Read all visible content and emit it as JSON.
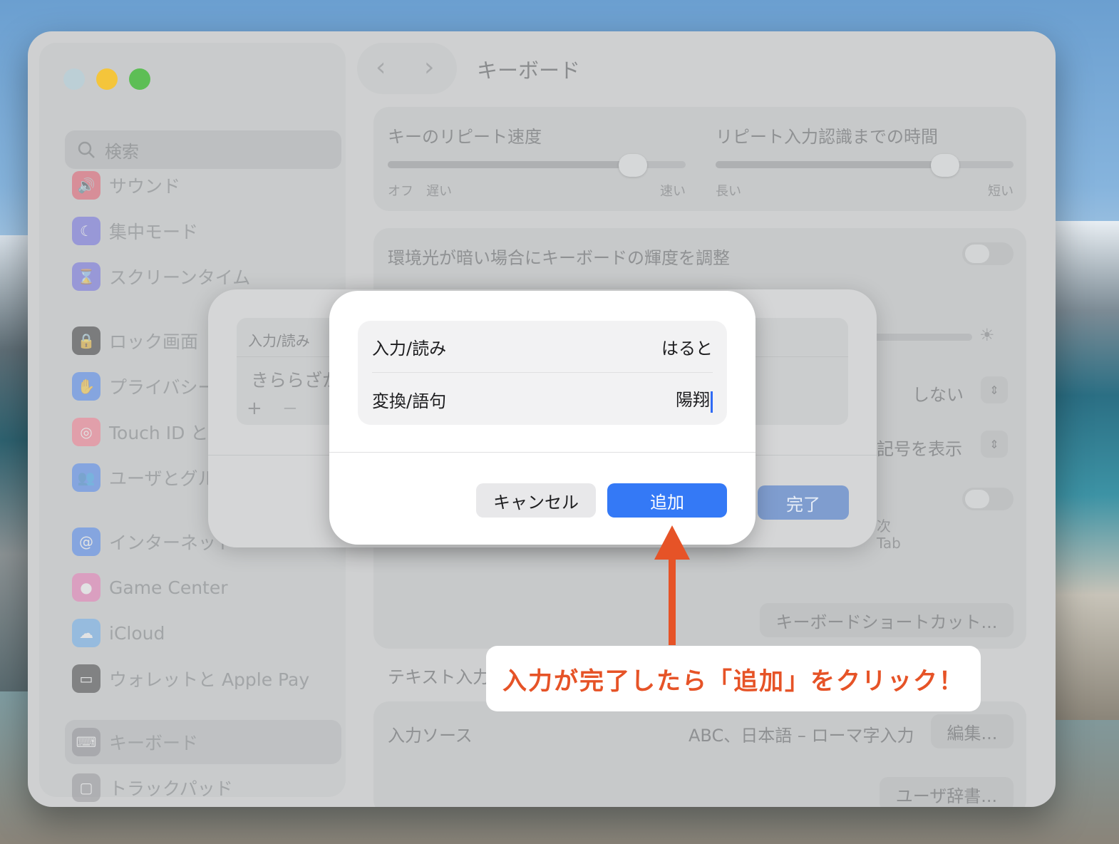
{
  "window": {
    "title": "キーボード",
    "nav_back": "‹",
    "nav_forward": "›"
  },
  "sidebar": {
    "search_placeholder": "検索",
    "items": [
      {
        "label": "サウンド",
        "icon": "speaker-icon",
        "color": "#e8455a"
      },
      {
        "label": "集中モード",
        "icon": "moon-icon",
        "color": "#5e5ce6"
      },
      {
        "label": "スクリーンタイム",
        "icon": "hourglass-icon",
        "color": "#5e5ce6"
      },
      {
        "label": "ロック画面",
        "icon": "lock-icon",
        "color": "#1d1d1f"
      },
      {
        "label": "プライバシーと",
        "icon": "hand-icon",
        "color": "#3478f6"
      },
      {
        "label": "Touch ID とパ",
        "icon": "fingerprint-icon",
        "color": "#ff6b81"
      },
      {
        "label": "ユーザとグルー",
        "icon": "users-icon",
        "color": "#3478f6"
      },
      {
        "label": "インターネット",
        "icon": "at-icon",
        "color": "#3478f6"
      },
      {
        "label": "Game Center",
        "icon": "game-center-icon",
        "color": "#f06ab2"
      },
      {
        "label": "iCloud",
        "icon": "cloud-icon",
        "color": "#5aa9f5"
      },
      {
        "label": "ウォレットと Apple Pay",
        "icon": "wallet-icon",
        "color": "#2b2b2b"
      },
      {
        "label": "キーボード",
        "icon": "keyboard-icon",
        "color": "#8e8e93"
      },
      {
        "label": "トラックパッド",
        "icon": "trackpad-icon",
        "color": "#8e8e93"
      }
    ]
  },
  "keyboard_settings": {
    "repeat_speed": {
      "label": "キーのリピート速度",
      "min_label": "オフ",
      "slow_label": "遅い",
      "max_label": "速い",
      "value": 0.82
    },
    "repeat_delay": {
      "label": "リピート入力認識までの時間",
      "min_label": "長い",
      "max_label": "短い",
      "value": 0.77
    },
    "ambient_light": {
      "label": "環境光が暗い場合にキーボードの輝度を調整",
      "on": false
    },
    "popup1_value": "しない",
    "popup2_value": "記号を表示",
    "tab_hint_1": "次",
    "tab_hint_2": "Tab",
    "shortcuts_button": "キーボードショートカット...",
    "text_input_heading": "テキスト入力",
    "input_sources_label": "入力ソース",
    "input_sources_value": "ABC、日本語 – ローマ字入力",
    "edit_button": "編集...",
    "user_dict_button": "ユーザ辞書..."
  },
  "sheet": {
    "column_header": "入力/読み",
    "row_value": "きららざか",
    "add_button": "+",
    "remove_button": "−",
    "done_button": "完了"
  },
  "dialog": {
    "input_label": "入力/読み",
    "input_value": "はると",
    "phrase_label": "変換/語句",
    "phrase_value": "陽翔",
    "cancel_button": "キャンセル",
    "add_button": "追加"
  },
  "annotation": {
    "text": "入力が完了したら「追加」をクリック！",
    "color": "#e65327"
  }
}
